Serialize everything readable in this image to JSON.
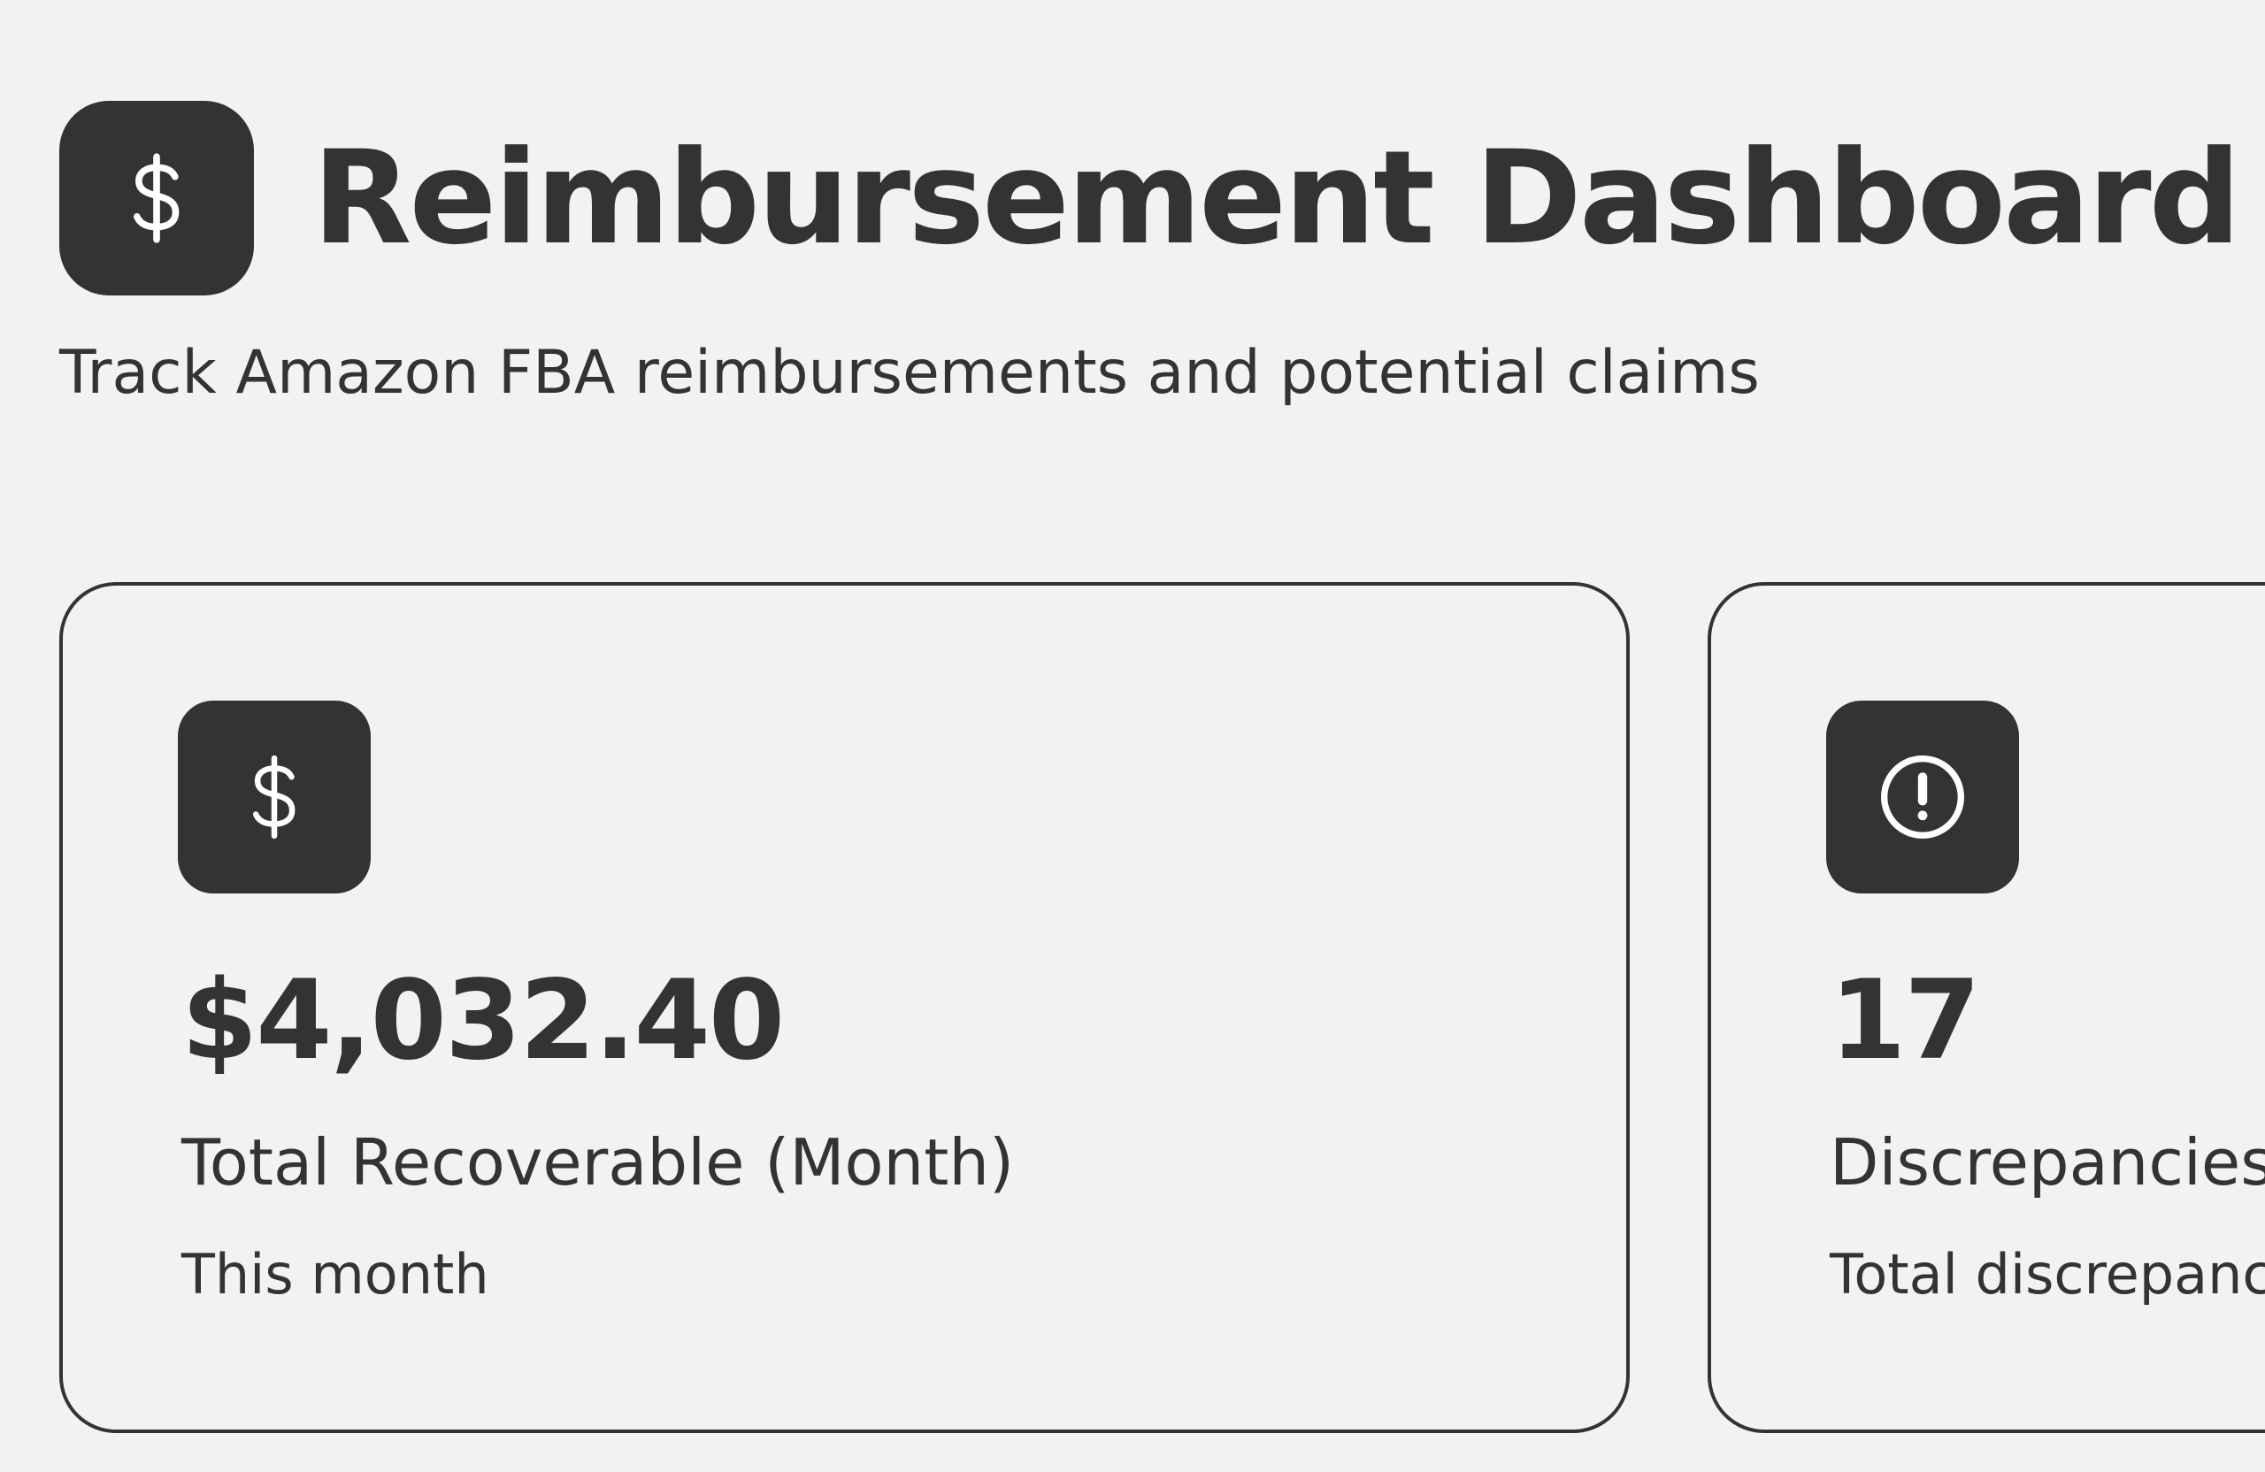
{
  "header": {
    "title": "Reimbursement Dashboard",
    "subtitle": "Track Amazon FBA reimbursements and potential claims",
    "icon": "dollar-icon"
  },
  "cards": [
    {
      "icon": "dollar-icon",
      "value": "$4,032.40",
      "label": "Total Recoverable (Month)",
      "sublabel": "This month"
    },
    {
      "icon": "alert-circle-icon",
      "value": "17",
      "label": "Discrepancies",
      "sublabel": "Total discrepancies"
    }
  ],
  "colors": {
    "background": "#f2f2f0",
    "foreground": "#333333",
    "icon_glyph": "#ffffff"
  }
}
